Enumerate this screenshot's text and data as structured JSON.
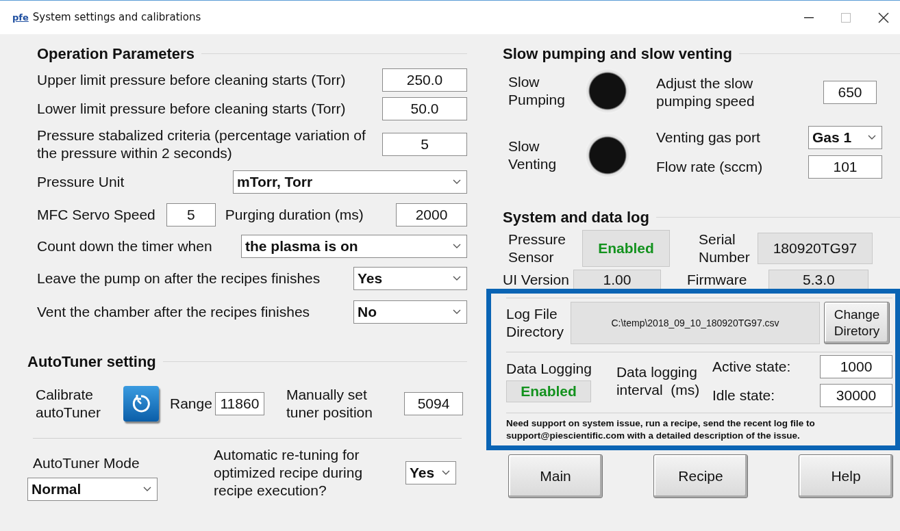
{
  "window": {
    "logo": "pfe",
    "title": "System settings and calibrations"
  },
  "operation_parameters": {
    "title": "Operation Parameters",
    "rows": [
      {
        "kind": "input",
        "label": "Upper limit pressure before cleaning starts (Torr)",
        "value": "250.0"
      },
      {
        "kind": "input",
        "label": "Lower limit pressure before cleaning starts (Torr)",
        "value": "50.0"
      },
      {
        "kind": "input",
        "label": "Pressure stabalized criteria (percentage variation of the pressure within 2 seconds)",
        "value": "5"
      },
      {
        "kind": "select",
        "label": "Pressure Unit",
        "value": "mTorr, Torr"
      },
      {
        "kind": "pair",
        "label": "MFC Servo Speed",
        "value": "5",
        "label_2": "Purging duration (ms)",
        "value_2": "2000"
      },
      {
        "kind": "select",
        "label": "Count down the timer when",
        "value": "the plasma is on"
      },
      {
        "kind": "select",
        "label": "Leave the pump on after the recipes finishes",
        "value": "Yes"
      },
      {
        "kind": "select",
        "label": "Vent the chamber after the recipes finishes",
        "value": "No"
      }
    ]
  },
  "autotuner": {
    "title": "AutoTuner setting",
    "calibrate_label": "Calibrate autoTuner",
    "range_label": "Range",
    "range_value": "11860",
    "manual_label": "Manually set tuner position",
    "manual_value": "5094",
    "mode_label": "AutoTuner Mode",
    "mode_value": "Normal",
    "retune_label": "Automatic re-tuning for optimized recipe during recipe execution?",
    "retune_value": "Yes"
  },
  "slow": {
    "title": "Slow pumping and slow venting",
    "pumping_label": "Slow Pumping",
    "pumping_on": false,
    "venting_label": "Slow Venting",
    "venting_on": false,
    "speed_label": "Adjust the slow pumping speed",
    "speed_value": "650",
    "gas_port_label": "Venting gas port",
    "gas_port_value": "Gas 1",
    "flow_label": "Flow rate (sccm)",
    "flow_value": "101"
  },
  "system_log": {
    "title": "System and data log",
    "pressure_sensor_label": "Pressure Sensor",
    "pressure_sensor_value": "Enabled",
    "serial_label": "Serial Number",
    "serial_value": "180920TG97",
    "ui_version_label": "UI Version",
    "ui_version_value": "1.00",
    "firmware_label": "Firmware",
    "firmware_value": "5.3.0"
  },
  "data_log": {
    "highlighted": true,
    "log_file_label": "Log File Directory",
    "log_file_value": "C:\\temp\\2018_09_10_180920TG97.csv",
    "change_button": "Change Diretory",
    "data_logging_label": "Data Logging",
    "data_logging_value": "Enabled",
    "interval_label": "Data logging interval  (ms)",
    "active_label": "Active state:",
    "active_value": "1000",
    "idle_label": "Idle state:",
    "idle_value": "30000",
    "support_note": "Need support on system issue, run a recipe, send the recent log file to support@piescientific.com with a detailed description of the issue."
  },
  "buttons": [
    "Main",
    "Recipe",
    "Help"
  ]
}
